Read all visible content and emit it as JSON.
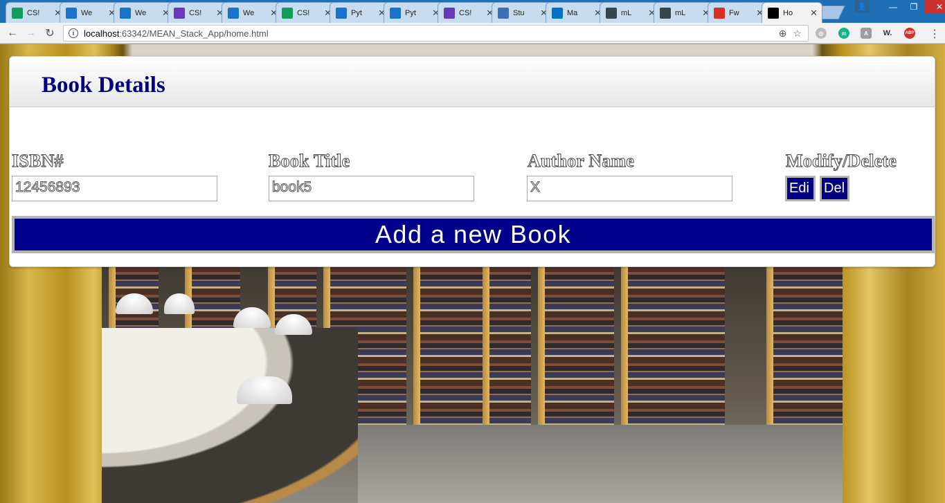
{
  "browser": {
    "tabs": [
      {
        "title": "CS!",
        "icon": "sheets-icon",
        "color": "#0f9d58"
      },
      {
        "title": "We",
        "icon": "box-icon",
        "color": "#1a73c9"
      },
      {
        "title": "We",
        "icon": "box-icon",
        "color": "#1a73c9"
      },
      {
        "title": "CS!",
        "icon": "forms-icon",
        "color": "#673ab7"
      },
      {
        "title": "We",
        "icon": "box-icon",
        "color": "#1a73c9"
      },
      {
        "title": "CS!",
        "icon": "sheets-icon",
        "color": "#0f9d58"
      },
      {
        "title": "Pyt",
        "icon": "box-icon",
        "color": "#1a73c9"
      },
      {
        "title": "Pyt",
        "icon": "box-icon",
        "color": "#1a73c9"
      },
      {
        "title": "CS!",
        "icon": "forms-icon",
        "color": "#673ab7"
      },
      {
        "title": "Stu",
        "icon": "docs-icon",
        "color": "#3b6fb6"
      },
      {
        "title": "Ma",
        "icon": "outlook-icon",
        "color": "#0072c6"
      },
      {
        "title": "mL",
        "icon": "mlab-icon",
        "color": "#37474f"
      },
      {
        "title": "mL",
        "icon": "mlab-icon",
        "color": "#37474f"
      },
      {
        "title": "Fw",
        "icon": "gmail-icon",
        "color": "#d93025"
      },
      {
        "title": "Ho",
        "icon": "webstorm-icon",
        "color": "#000000"
      }
    ],
    "url_host": "localhost",
    "url_rest": ":63342/MEAN_Stack_App/home.html"
  },
  "page": {
    "title": "Book Details",
    "columns": {
      "isbn": "ISBN#",
      "title": "Book Title",
      "author": "Author Name",
      "actions": "Modify/Delete"
    },
    "book": {
      "isbn": "12456893",
      "title": "book5",
      "author": "X"
    },
    "edit_label": "Edi",
    "delete_label": "Del",
    "add_label": "Add a new Book"
  }
}
